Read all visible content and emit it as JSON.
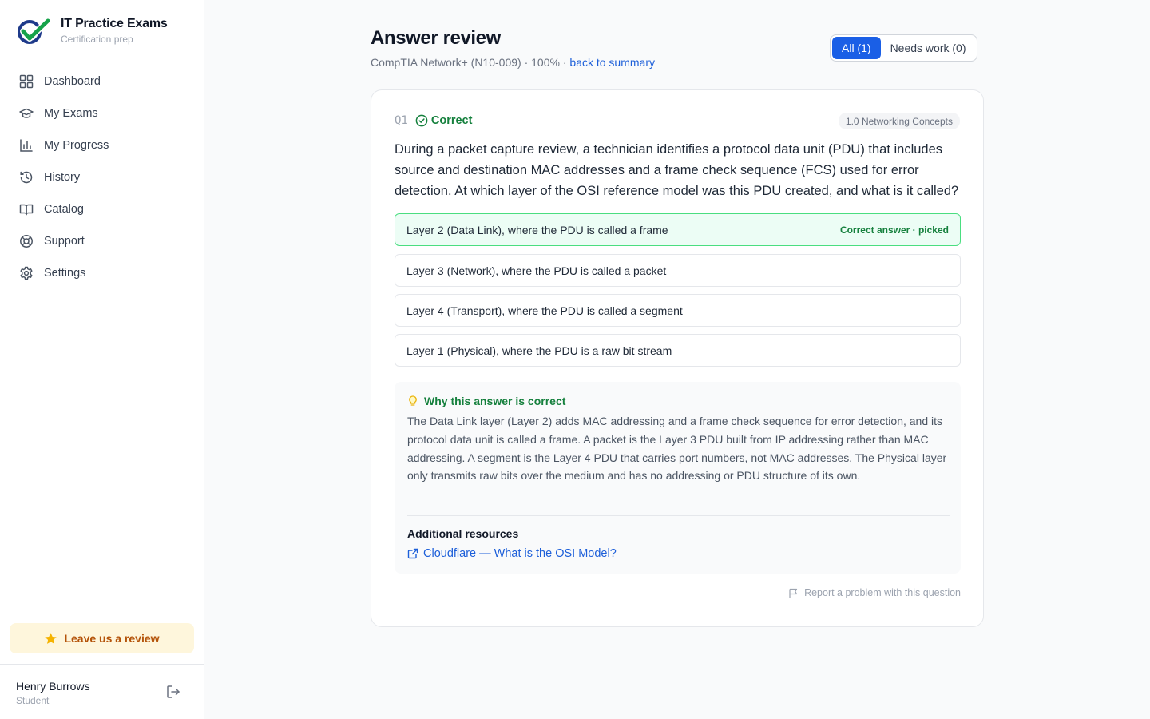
{
  "brand": {
    "title": "IT Practice Exams",
    "subtitle": "Certification prep"
  },
  "nav": [
    {
      "label": "Dashboard",
      "icon": "dashboard-icon"
    },
    {
      "label": "My Exams",
      "icon": "graduation-cap-icon"
    },
    {
      "label": "My Progress",
      "icon": "bar-chart-icon"
    },
    {
      "label": "History",
      "icon": "history-icon"
    },
    {
      "label": "Catalog",
      "icon": "book-icon"
    },
    {
      "label": "Support",
      "icon": "lifebuoy-icon"
    },
    {
      "label": "Settings",
      "icon": "gear-icon"
    }
  ],
  "review_cta": {
    "label": "Leave us a review",
    "icon": "star-icon"
  },
  "user": {
    "name": "Henry Burrows",
    "role": "Student"
  },
  "header": {
    "title": "Answer review",
    "exam": "CompTIA Network+ (N10-009)",
    "separator": "·",
    "score": "100%",
    "back_link": "back to summary"
  },
  "filters": [
    {
      "label": "All (1)",
      "active": true
    },
    {
      "label": "Needs work (0)",
      "active": false
    }
  ],
  "question": {
    "number": "Q1",
    "status": "Correct",
    "domain": "1.0 Networking Concepts",
    "text": "During a packet capture review, a technician identifies a protocol data unit (PDU) that includes source and destination MAC addresses and a frame check sequence (FCS) used for error detection. At which layer of the OSI reference model was this PDU created, and what is it called?",
    "options": [
      {
        "text": "Layer 2 (Data Link), where the PDU is called a frame",
        "tag": "Correct answer · picked",
        "correct": true
      },
      {
        "text": "Layer 3 (Network), where the PDU is called a packet",
        "tag": "",
        "correct": false
      },
      {
        "text": "Layer 4 (Transport), where the PDU is called a segment",
        "tag": "",
        "correct": false
      },
      {
        "text": "Layer 1 (Physical), where the PDU is a raw bit stream",
        "tag": "",
        "correct": false
      }
    ],
    "explanation": {
      "title": "Why this answer is correct",
      "body": "The Data Link layer (Layer 2) adds MAC addressing and a frame check sequence for error detection, and its protocol data unit is called a frame. A packet is the Layer 3 PDU built from IP addressing rather than MAC addressing. A segment is the Layer 4 PDU that carries port numbers, not MAC addresses. The Physical layer only transmits raw bits over the medium and has no addressing or PDU structure of its own.",
      "resources_title": "Additional resources",
      "resources": [
        {
          "label": "Cloudflare — What is the OSI Model?"
        }
      ]
    },
    "report_label": "Report a problem with this question"
  },
  "colors": {
    "accent": "#1a5fe6",
    "success": "#15803d",
    "link": "#1d5fd9",
    "review_bg": "#fef6dc",
    "review_text": "#b45309"
  }
}
